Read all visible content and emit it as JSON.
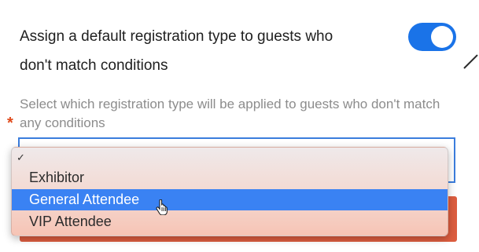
{
  "setting": {
    "label": "Assign a default registration type to guests who don't match conditions",
    "toggle_on": true,
    "toggle_color": "#1a73e8"
  },
  "field": {
    "required_mark": "*",
    "helper_text": "Select which registration type will be applied to guests who don't match any conditions",
    "selected_value": ""
  },
  "dropdown": {
    "check_glyph": "✓",
    "options": [
      {
        "label": ""
      },
      {
        "label": "Exhibitor"
      },
      {
        "label": "General Attendee",
        "highlighted": true
      },
      {
        "label": "VIP Attendee"
      }
    ],
    "highlight_color": "#3a82f3"
  },
  "colors": {
    "accent_orange": "#dc5d3f",
    "select_border": "#3b7ddd",
    "required": "#e0491a"
  },
  "icons": {
    "cursor": "hand-pointer-icon",
    "check": "checkmark-icon"
  }
}
